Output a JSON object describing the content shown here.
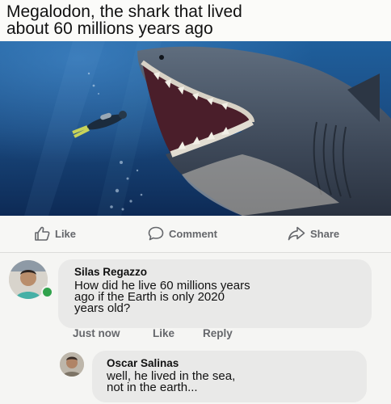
{
  "post": {
    "title_line1": "Megalodon, the shark that lived",
    "title_line2": "about 60 millions years ago"
  },
  "actions": {
    "like_label": "Like",
    "comment_label": "Comment",
    "share_label": "Share"
  },
  "comments": [
    {
      "author": "Silas Regazzo",
      "text_line1": "How did he live 60 millions years",
      "text_line2": "ago if the Earth is only 2020",
      "text_line3": "years old?",
      "time": "Just now",
      "like_label": "Like",
      "reply_label": "Reply",
      "online": true
    },
    {
      "author": "Oscar Salinas",
      "text_line1": "well, he lived in the sea,",
      "text_line2": "not in the earth..."
    }
  ],
  "colors": {
    "meta_text": "#65676b",
    "bubble": "#e9e9e8",
    "online_dot": "#31a24c",
    "ocean": "#1c4f86"
  },
  "icons": [
    "thumbs-up-icon",
    "comment-icon",
    "share-icon",
    "online-indicator"
  ]
}
